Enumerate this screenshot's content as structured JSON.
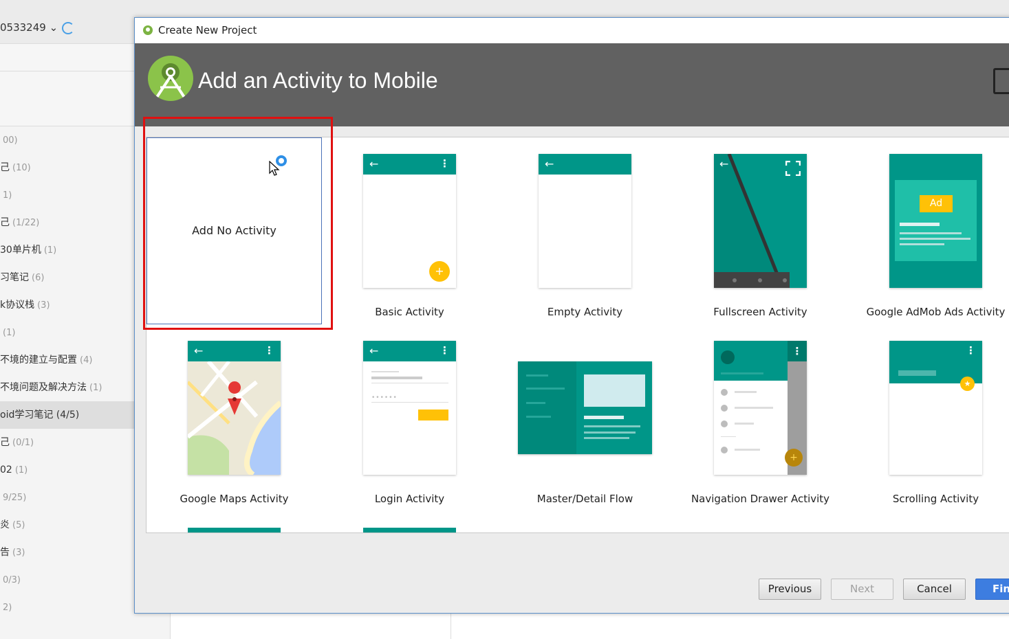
{
  "background_app": {
    "account_label": "0533249",
    "notebooks": [
      {
        "name": "",
        "count": "00)"
      },
      {
        "name": "己",
        "count": "(10)"
      },
      {
        "name": "",
        "count": "1)"
      },
      {
        "name": "己",
        "count": "(1/22)"
      },
      {
        "name": "30单片机",
        "count": "(1)"
      },
      {
        "name": "习笔记",
        "count": "(6)"
      },
      {
        "name": "k协议栈",
        "count": "(3)"
      },
      {
        "name": "",
        "count": "(1)"
      },
      {
        "name": "不境的建立与配置",
        "count": "(4)"
      },
      {
        "name": "不境问题及解决方法",
        "count": "(1)"
      },
      {
        "name": "oid学习笔记 (4/5)",
        "count": ""
      },
      {
        "name": "己",
        "count": "(0/1)"
      },
      {
        "name": "02",
        "count": "(1)"
      },
      {
        "name": "",
        "count": "9/25)"
      },
      {
        "name": "炎",
        "count": "(5)"
      },
      {
        "name": "告",
        "count": "(3)"
      },
      {
        "name": "",
        "count": "0/3)"
      },
      {
        "name": "",
        "count": "2)"
      }
    ]
  },
  "dialog": {
    "window_title": "Create New Project",
    "header_title": "Add an Activity to Mobile",
    "templates": [
      {
        "label": "Add No Activity"
      },
      {
        "label": "Basic Activity"
      },
      {
        "label": "Empty Activity"
      },
      {
        "label": "Fullscreen Activity"
      },
      {
        "label": "Google AdMob Ads Activity",
        "badge": "Ad"
      },
      {
        "label": "Google Maps Activity"
      },
      {
        "label": "Login Activity"
      },
      {
        "label": "Master/Detail Flow"
      },
      {
        "label": "Navigation Drawer Activity"
      },
      {
        "label": "Scrolling Activity"
      }
    ],
    "buttons": {
      "previous": "Previous",
      "next": "Next",
      "cancel": "Cancel",
      "finish": "Fini"
    }
  },
  "colors": {
    "teal": "#009688",
    "header_bg": "#616161",
    "highlight": "#e01010",
    "fab": "#ffc107",
    "android_green": "#8bc34a"
  }
}
